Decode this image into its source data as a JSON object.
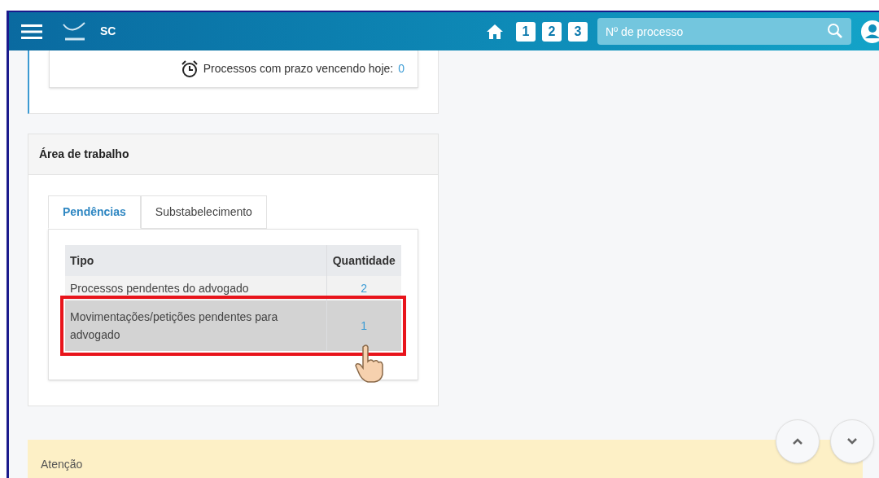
{
  "header": {
    "site": "SC",
    "shortcuts": [
      "1",
      "2",
      "3"
    ],
    "search": {
      "placeholder": "Nº de processo"
    }
  },
  "deadline": {
    "label": "Processos com prazo vencendo hoje:",
    "count": "0"
  },
  "workspace": {
    "title": "Área de trabalho",
    "tabs": [
      {
        "label": "Pendências",
        "selected": true
      },
      {
        "label": "Substabelecimento",
        "selected": false
      }
    ],
    "table": {
      "columns": [
        "Tipo",
        "Quantidade"
      ],
      "rows": [
        {
          "tipo": "Processos pendentes do advogado",
          "quantidade": "2",
          "highlighted": false
        },
        {
          "tipo": "Movimentações/petições pendentes para advogado",
          "quantidade": "1",
          "highlighted": true
        }
      ]
    }
  },
  "notice": {
    "title": "Atenção"
  }
}
